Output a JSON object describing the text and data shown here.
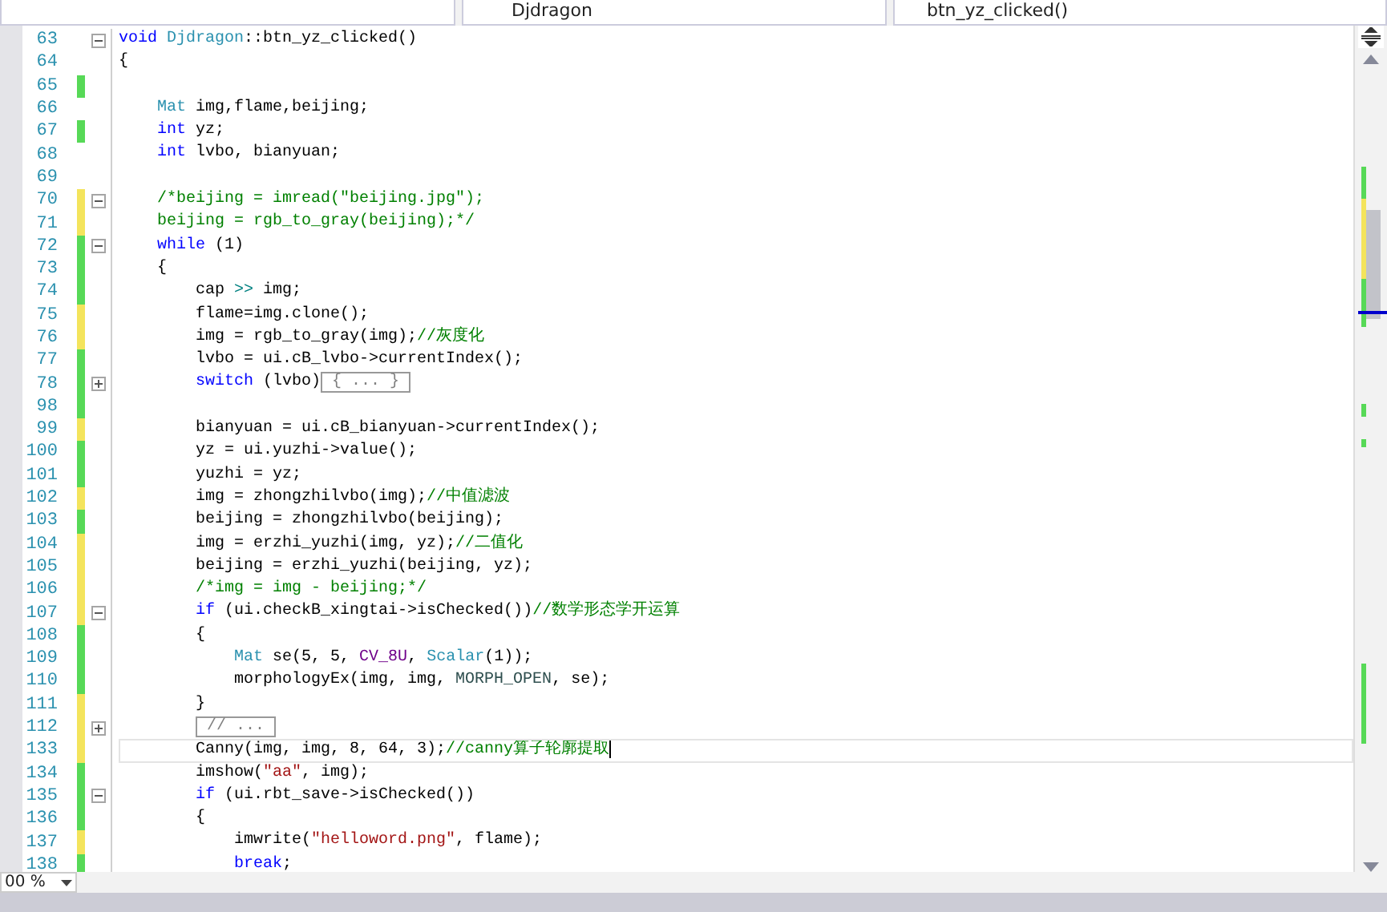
{
  "navigation_bar": {
    "class_dropdown": "Djdragon",
    "member_dropdown": "btn_yz_clicked()"
  },
  "editor": {
    "lines": [
      {
        "number": "63",
        "fold": {
          "expanded": true
        },
        "current": false,
        "tokens": [
          {
            "kind": "keyword",
            "text": "void"
          },
          {
            "kind": "type",
            "text": " Djdragon"
          },
          {
            "kind": "plain",
            "text": "::btn_yz_clicked()"
          }
        ]
      },
      {
        "number": "64",
        "current": false,
        "tokens": [
          {
            "kind": "plain",
            "text": "{"
          }
        ]
      },
      {
        "number": "65",
        "color": "#57d957",
        "current": false
      },
      {
        "number": "66",
        "current": false,
        "tokens": [
          {
            "kind": "type",
            "text": "    Mat"
          },
          {
            "kind": "plain",
            "text": " img,flame,beijing;"
          }
        ]
      },
      {
        "number": "67",
        "color": "#57d957",
        "current": false,
        "tokens": [
          {
            "kind": "keyword",
            "text": "    int"
          },
          {
            "kind": "plain",
            "text": " yz;"
          }
        ]
      },
      {
        "number": "68",
        "current": false,
        "tokens": [
          {
            "kind": "keyword",
            "text": "    int"
          },
          {
            "kind": "plain",
            "text": " lvbo, bianyuan;"
          }
        ]
      },
      {
        "number": "69",
        "current": false
      },
      {
        "number": "70",
        "color": "#f4e45c",
        "fold": {
          "expanded": true
        },
        "current": false,
        "tokens": [
          {
            "kind": "comment",
            "text": "    /*beijing = imread(\"beijing.jpg\");"
          }
        ]
      },
      {
        "number": "71",
        "color": "#f4e45c",
        "current": false,
        "tokens": [
          {
            "kind": "comment",
            "text": "    beijing = rgb_to_gray(beijing);*/"
          }
        ]
      },
      {
        "number": "72",
        "color": "#57d957",
        "fold": {
          "expanded": true
        },
        "current": false,
        "tokens": [
          {
            "kind": "keyword",
            "text": "    while"
          },
          {
            "kind": "plain",
            "text": " (1)"
          }
        ]
      },
      {
        "number": "73",
        "color": "#57d957",
        "current": false,
        "tokens": [
          {
            "kind": "plain",
            "text": "    {"
          }
        ]
      },
      {
        "number": "74",
        "color": "#57d957",
        "current": false,
        "tokens": [
          {
            "kind": "plain",
            "text": "        cap "
          },
          {
            "kind": "operator",
            "text": ">>"
          },
          {
            "kind": "plain",
            "text": " img;"
          }
        ]
      },
      {
        "number": "75",
        "color": "#f4e45c",
        "current": false,
        "tokens": [
          {
            "kind": "plain",
            "text": "        flame=img.clone();"
          }
        ]
      },
      {
        "number": "76",
        "color": "#f4e45c",
        "current": false,
        "tokens": [
          {
            "kind": "plain",
            "text": "        img = rgb_to_gray(img);"
          },
          {
            "kind": "comment",
            "text": "//灰度化"
          }
        ]
      },
      {
        "number": "77",
        "color": "#57d957",
        "current": false,
        "tokens": [
          {
            "kind": "plain",
            "text": "        lvbo = ui.cB_lvbo->currentIndex();"
          }
        ]
      },
      {
        "number": "78",
        "color": "#57d957",
        "fold": {
          "expanded": false
        },
        "current": false,
        "tokens": [
          {
            "kind": "keyword",
            "text": "        switch"
          },
          {
            "kind": "plain",
            "text": " (lvbo)"
          },
          {
            "kind": "collapsed",
            "text": "{ ... }"
          }
        ]
      },
      {
        "number": "98",
        "color": "#57d957",
        "current": false
      },
      {
        "number": "99",
        "color": "#f4e45c",
        "current": false,
        "tokens": [
          {
            "kind": "plain",
            "text": "        bianyuan = ui.cB_bianyuan->currentIndex();"
          }
        ]
      },
      {
        "number": "100",
        "color": "#57d957",
        "current": false,
        "tokens": [
          {
            "kind": "plain",
            "text": "        yz = ui.yuzhi->value();"
          }
        ]
      },
      {
        "number": "101",
        "color": "#57d957",
        "current": false,
        "tokens": [
          {
            "kind": "plain",
            "text": "        yuzhi = yz;"
          }
        ]
      },
      {
        "number": "102",
        "color": "#f4e45c",
        "current": false,
        "tokens": [
          {
            "kind": "plain",
            "text": "        img = zhongzhilvbo(img);"
          },
          {
            "kind": "comment",
            "text": "//中值滤波"
          }
        ]
      },
      {
        "number": "103",
        "color": "#57d957",
        "current": false,
        "tokens": [
          {
            "kind": "plain",
            "text": "        beijing = zhongzhilvbo(beijing);"
          }
        ]
      },
      {
        "number": "104",
        "color": "#f4e45c",
        "current": false,
        "tokens": [
          {
            "kind": "plain",
            "text": "        img = erzhi_yuzhi(img, yz);"
          },
          {
            "kind": "comment",
            "text": "//二值化"
          }
        ]
      },
      {
        "number": "105",
        "color": "#f4e45c",
        "current": false,
        "tokens": [
          {
            "kind": "plain",
            "text": "        beijing = erzhi_yuzhi(beijing, yz);"
          }
        ]
      },
      {
        "number": "106",
        "color": "#f4e45c",
        "current": false,
        "tokens": [
          {
            "kind": "comment",
            "text": "        /*img = img - beijing;*/"
          }
        ]
      },
      {
        "number": "107",
        "color": "#f4e45c",
        "fold": {
          "expanded": true
        },
        "current": false,
        "tokens": [
          {
            "kind": "keyword",
            "text": "        if"
          },
          {
            "kind": "plain",
            "text": " (ui.checkB_xingtai->isChecked())"
          },
          {
            "kind": "comment",
            "text": "//数学形态学开运算"
          }
        ]
      },
      {
        "number": "108",
        "color": "#57d957",
        "current": false,
        "tokens": [
          {
            "kind": "plain",
            "text": "        {"
          }
        ]
      },
      {
        "number": "109",
        "color": "#57d957",
        "current": false,
        "tokens": [
          {
            "kind": "type",
            "text": "            Mat"
          },
          {
            "kind": "plain",
            "text": " se(5, 5, "
          },
          {
            "kind": "macro",
            "text": "CV_8U"
          },
          {
            "kind": "plain",
            "text": ", "
          },
          {
            "kind": "type",
            "text": "Scalar"
          },
          {
            "kind": "plain",
            "text": "(1));"
          }
        ]
      },
      {
        "number": "110",
        "color": "#57d957",
        "current": false,
        "tokens": [
          {
            "kind": "plain",
            "text": "            morphologyEx(img, img, "
          },
          {
            "kind": "enum",
            "text": "MORPH_OPEN"
          },
          {
            "kind": "plain",
            "text": ", se);"
          }
        ]
      },
      {
        "number": "111",
        "color": "#f4e45c",
        "current": false,
        "tokens": [
          {
            "kind": "plain",
            "text": "        }"
          }
        ]
      },
      {
        "number": "112",
        "color": "#f4e45c",
        "fold": {
          "expanded": false
        },
        "current": false,
        "tokens": [
          {
            "kind": "collapsed",
            "text": "        // ..."
          }
        ]
      },
      {
        "number": "133",
        "color": "#f4e45c",
        "current": true,
        "tokens": [
          {
            "kind": "plain",
            "text": "        Canny(img, img, 8, 64, 3);"
          },
          {
            "kind": "comment",
            "text": "//canny算子轮廓提取"
          }
        ]
      },
      {
        "number": "134",
        "color": "#57d957",
        "current": false,
        "tokens": [
          {
            "kind": "plain",
            "text": "        imshow("
          },
          {
            "kind": "string",
            "text": "\"aa\""
          },
          {
            "kind": "plain",
            "text": ", img);"
          }
        ]
      },
      {
        "number": "135",
        "color": "#57d957",
        "fold": {
          "expanded": true
        },
        "current": false,
        "tokens": [
          {
            "kind": "keyword",
            "text": "        if"
          },
          {
            "kind": "plain",
            "text": " (ui.rbt_save->isChecked())"
          }
        ]
      },
      {
        "number": "136",
        "color": "#57d957",
        "current": false,
        "tokens": [
          {
            "kind": "plain",
            "text": "        {"
          }
        ]
      },
      {
        "number": "137",
        "color": "#f4e45c",
        "current": false,
        "tokens": [
          {
            "kind": "plain",
            "text": "            imwrite("
          },
          {
            "kind": "string",
            "text": "\"helloword.png\""
          },
          {
            "kind": "plain",
            "text": ", flame);"
          }
        ]
      },
      {
        "number": "138",
        "color": "#57d957",
        "current": false,
        "tokens": [
          {
            "kind": "keyword",
            "text": "            break"
          },
          {
            "kind": "plain",
            "text": ";"
          }
        ]
      }
    ]
  },
  "status_bar": {
    "zoom": "00 %"
  }
}
